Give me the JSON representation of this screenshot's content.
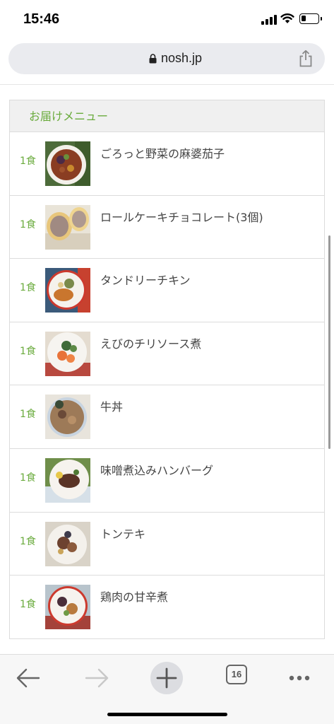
{
  "status": {
    "time": "15:46",
    "battery_level": 0.3
  },
  "browser": {
    "url": "nosh.jp",
    "tab_count": "16"
  },
  "menu": {
    "title": "お届けメニュー",
    "items": [
      {
        "qty": "1食",
        "name": "ごろっと野菜の麻婆茄子"
      },
      {
        "qty": "1食",
        "name": "ロールケーキチョコレート(3個)"
      },
      {
        "qty": "1食",
        "name": "タンドリーチキン"
      },
      {
        "qty": "1食",
        "name": "えびのチリソース煮"
      },
      {
        "qty": "1食",
        "name": "牛丼"
      },
      {
        "qty": "1食",
        "name": "味噌煮込みハンバーグ"
      },
      {
        "qty": "1食",
        "name": "トンテキ"
      },
      {
        "qty": "1食",
        "name": "鶏肉の甘辛煮"
      }
    ]
  },
  "colors": {
    "accent": "#6aab3d",
    "url_bar": "#eaebef"
  }
}
